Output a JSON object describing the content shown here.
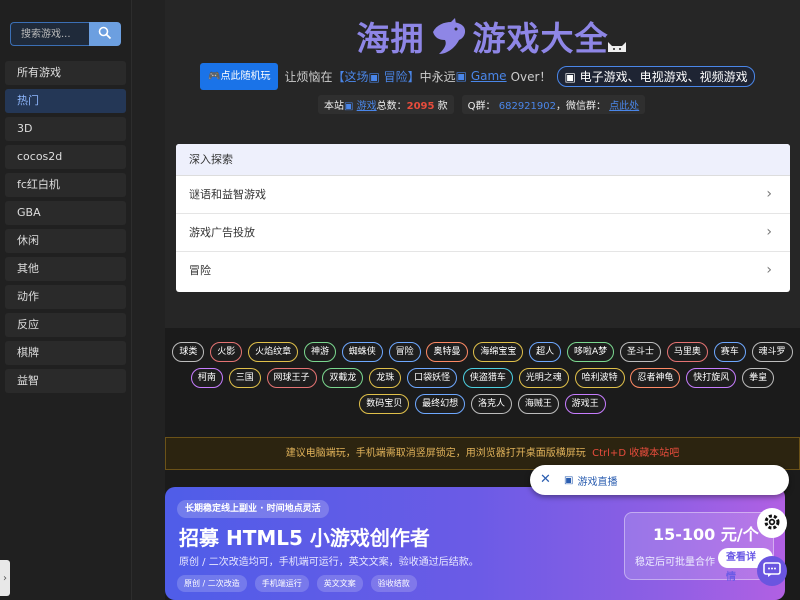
{
  "search": {
    "placeholder": "搜索游戏..."
  },
  "sidebar": {
    "items": [
      {
        "label": "所有游戏"
      },
      {
        "label": "热门"
      },
      {
        "label": "3D"
      },
      {
        "label": "cocos2d"
      },
      {
        "label": "fc红白机"
      },
      {
        "label": "GBA"
      },
      {
        "label": "休闲"
      },
      {
        "label": "其他"
      },
      {
        "label": "动作"
      },
      {
        "label": "反应"
      },
      {
        "label": "棋牌"
      },
      {
        "label": "益智"
      }
    ],
    "collapse_glyph": "›"
  },
  "header": {
    "title_left": "海拥",
    "title_right": "游戏大全",
    "random_label": "点此随机玩",
    "intro_1": "让烦恼在",
    "intro_2": "【这场",
    "intro_3": "冒险】",
    "intro_4": "中永远",
    "intro_5": "Game",
    "intro_6": "Over！",
    "pill": "电子游戏、电视游戏、视频游戏",
    "stats": {
      "site_label": "本站",
      "games_word": "游戏",
      "total_label": "总数：",
      "total": "2095",
      "unit": "款",
      "qq_label": "Q群：",
      "qq": "682921902",
      "wechat_label": "，微信群：",
      "wechat_link": "点此处"
    }
  },
  "explore": {
    "title": "深入探索",
    "items": [
      {
        "label": "谜语和益智游戏"
      },
      {
        "label": "游戏广告投放"
      },
      {
        "label": "冒险"
      }
    ],
    "chevron": "›"
  },
  "tags": [
    {
      "label": "球类",
      "color": "#bdbdbd"
    },
    {
      "label": "火影",
      "color": "#e57373"
    },
    {
      "label": "火焰纹章",
      "color": "#e0c04a"
    },
    {
      "label": "神游",
      "color": "#7bd88f"
    },
    {
      "label": "蜘蛛侠",
      "color": "#6ea8ff"
    },
    {
      "label": "冒险",
      "color": "#6ea8ff"
    },
    {
      "label": "奥特曼",
      "color": "#ff8a65"
    },
    {
      "label": "海绵宝宝",
      "color": "#e0c04a"
    },
    {
      "label": "超人",
      "color": "#6ea8ff"
    },
    {
      "label": "哆啦A梦",
      "color": "#7bd88f"
    },
    {
      "label": "圣斗士",
      "color": "#bdbdbd"
    },
    {
      "label": "马里奥",
      "color": "#e57373"
    },
    {
      "label": "赛车",
      "color": "#6ea8ff"
    },
    {
      "label": "魂斗罗",
      "color": "#bdbdbd"
    },
    {
      "label": "柯南",
      "color": "#c77dff"
    },
    {
      "label": "三国",
      "color": "#e0c04a"
    },
    {
      "label": "网球王子",
      "color": "#e57373"
    },
    {
      "label": "双截龙",
      "color": "#7bd88f"
    },
    {
      "label": "龙珠",
      "color": "#e0c04a"
    },
    {
      "label": "口袋妖怪",
      "color": "#6ea8ff"
    },
    {
      "label": "侠盗猎车",
      "color": "#4dd0e1"
    },
    {
      "label": "光明之魂",
      "color": "#e0c04a"
    },
    {
      "label": "哈利波特",
      "color": "#e0c04a"
    },
    {
      "label": "忍者神龟",
      "color": "#ff8a65"
    },
    {
      "label": "快打旋风",
      "color": "#c77dff"
    },
    {
      "label": "拳皇",
      "color": "#bdbdbd"
    },
    {
      "label": "数码宝贝",
      "color": "#e0c04a"
    },
    {
      "label": "最终幻想",
      "color": "#6ea8ff"
    },
    {
      "label": "洛克人",
      "color": "#bdbdbd"
    },
    {
      "label": "海贼王",
      "color": "#bdbdbd"
    },
    {
      "label": "游戏王",
      "color": "#c77dff"
    }
  ],
  "notice": {
    "text": "建议电脑端玩，手机端需取消竖屏锁定，用浏览器打开桌面版横屏玩",
    "shortcut": "Ctrl+D 收藏本站吧"
  },
  "banner": {
    "tag": "长期稳定线上副业 · 时间地点灵活",
    "title": "招募 HTML5 小游戏创作者",
    "subtitle": "原创 / 二次改造均可，手机端可运行，英文文案，验收通过后结款。",
    "chips": [
      "原创 / 二次改造",
      "手机端运行",
      "英文文案",
      "验收结款"
    ],
    "price": "15-100 元/个",
    "price_note": "稳定后可批量合作",
    "detail_button": "查看详情"
  },
  "live_popup": {
    "close": "✕",
    "label": "游戏直播"
  },
  "colors": {
    "accent": "#8e86e6",
    "link": "#4a86e8",
    "active_bg": "#243756"
  }
}
